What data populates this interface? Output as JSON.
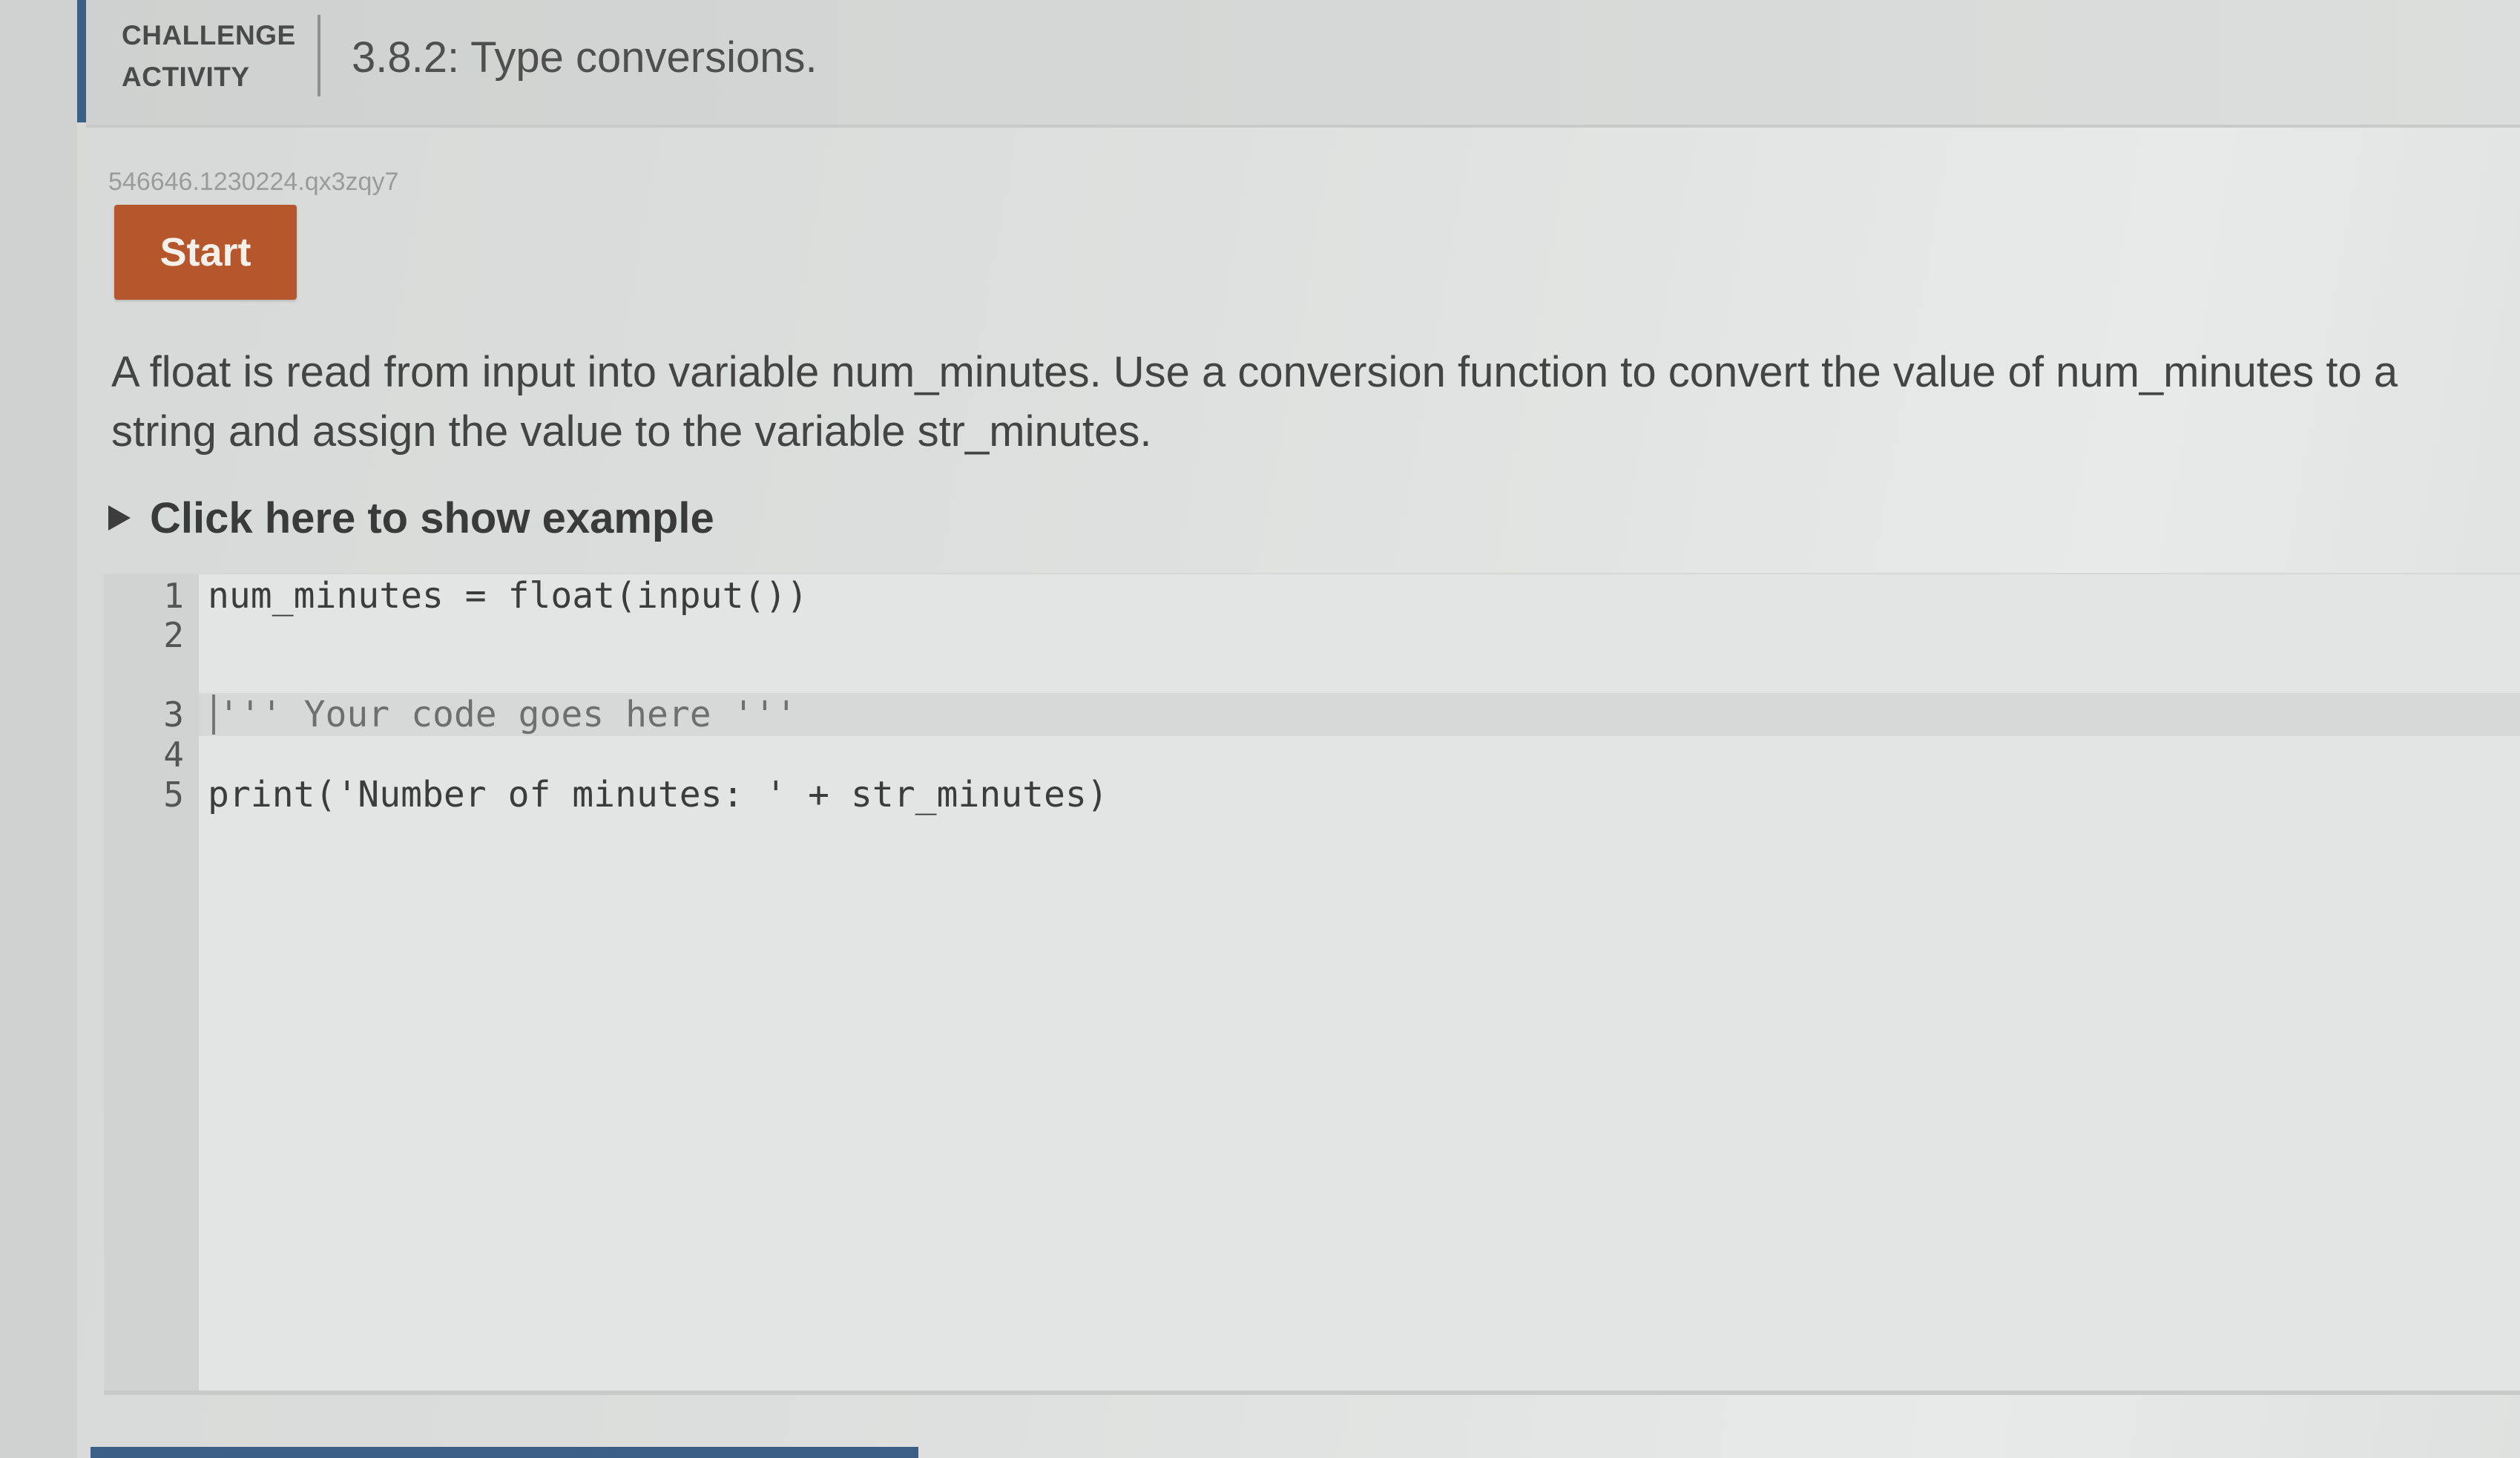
{
  "header": {
    "label": "CHALLENGE\nACTIVITY",
    "title": "3.8.2: Type conversions."
  },
  "activity": {
    "id": "546646.1230224.qx3zqy7",
    "start_label": "Start"
  },
  "instructions": "A float is read from input into variable num_minutes. Use a conversion function to convert the value of num_minutes to a string and assign the value to the variable str_minutes.",
  "example": {
    "label": "Click here to show example",
    "icon": "triangle-right-icon"
  },
  "editor": {
    "lines": [
      {
        "num": "1",
        "text": "num_minutes = float(input())"
      },
      {
        "num": "2",
        "text": ""
      },
      {
        "num": "3",
        "text": "''' Your code goes here '''"
      },
      {
        "num": "4",
        "text": ""
      },
      {
        "num": "5",
        "text": "print('Number of minutes: ' + str_minutes)"
      }
    ]
  },
  "colors": {
    "accent": "#3b5f86",
    "start_button": "#b5562c"
  }
}
